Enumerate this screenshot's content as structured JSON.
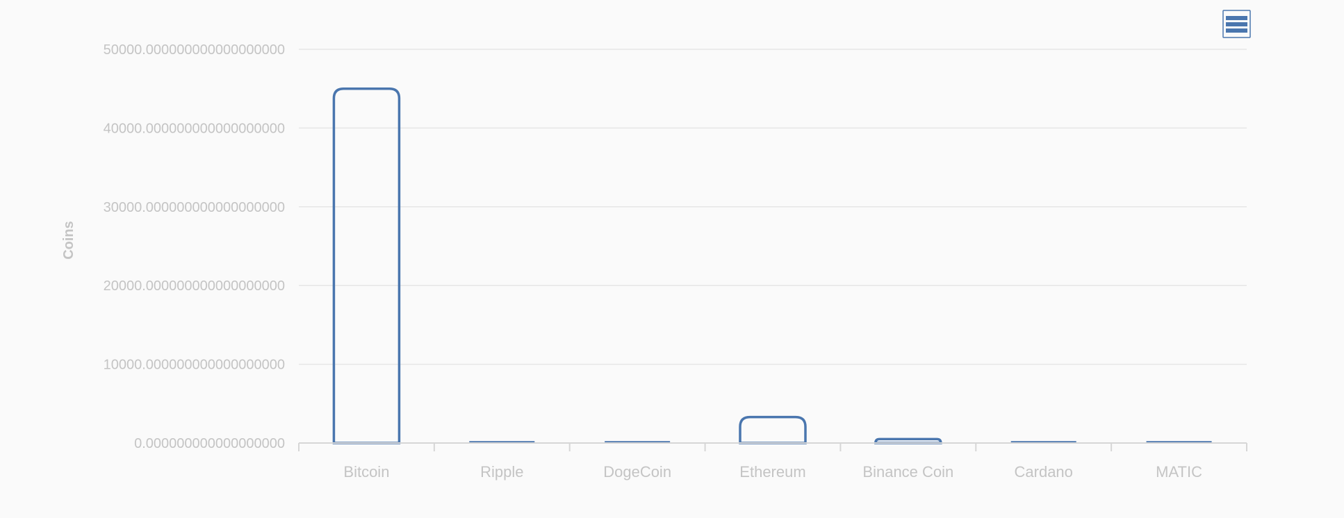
{
  "chart_data": {
    "type": "bar",
    "categories": [
      "Bitcoin",
      "Ripple",
      "DogeCoin",
      "Ethereum",
      "Binance Coin",
      "Cardano",
      "MATIC"
    ],
    "series": [
      {
        "values": [
          45000,
          0.8,
          0.15,
          3300,
          500,
          1.3,
          1.9
        ]
      }
    ],
    "ylabel": "Coins",
    "xlabel": "",
    "ylim": [
      0,
      50000
    ],
    "yticks": [
      0,
      10000,
      20000,
      30000,
      40000,
      50000
    ],
    "ytick_labels": [
      "0.000000000000000000",
      "10000.000000000000000000",
      "20000.000000000000000000",
      "30000.000000000000000000",
      "40000.000000000000000000",
      "50000.000000000000000000"
    ],
    "grid": true,
    "legend": "none",
    "bar_color": "#4a76ae"
  },
  "menu_icon": "hamburger-menu-icon"
}
